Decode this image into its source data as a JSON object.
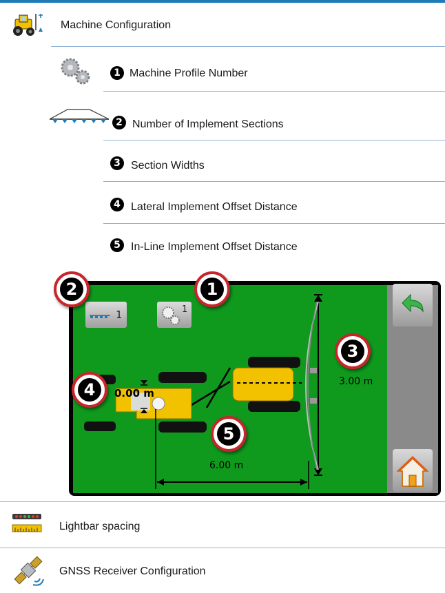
{
  "header": {
    "title": "Machine Configuration"
  },
  "items": [
    {
      "num": "1",
      "label": "Machine Profile Number"
    },
    {
      "num": "2",
      "label": "Number of Implement Sections"
    },
    {
      "num": "3",
      "label": "Section Widths"
    },
    {
      "num": "4",
      "label": "Lateral Implement Offset Distance"
    },
    {
      "num": "5",
      "label": "In-Line Implement Offset Distance"
    }
  ],
  "screen": {
    "sections_button_value": "1",
    "profile_button_value": "1",
    "lateral_offset": "0.00 m",
    "section_width": "3.00 m",
    "inline_offset": "6.00 m",
    "callouts": [
      "2",
      "1",
      "3",
      "4",
      "5"
    ]
  },
  "footer_items": [
    {
      "label": "Lightbar spacing",
      "icon": "lightbar-icon"
    },
    {
      "label": "GNSS Receiver Configuration",
      "icon": "satellite-icon"
    }
  ],
  "colors": {
    "accent_rule": "#8fb3d6",
    "top_bar": "#1f7ab8",
    "screen_green": "#0f9a1e",
    "callout_red": "#c8252b"
  }
}
